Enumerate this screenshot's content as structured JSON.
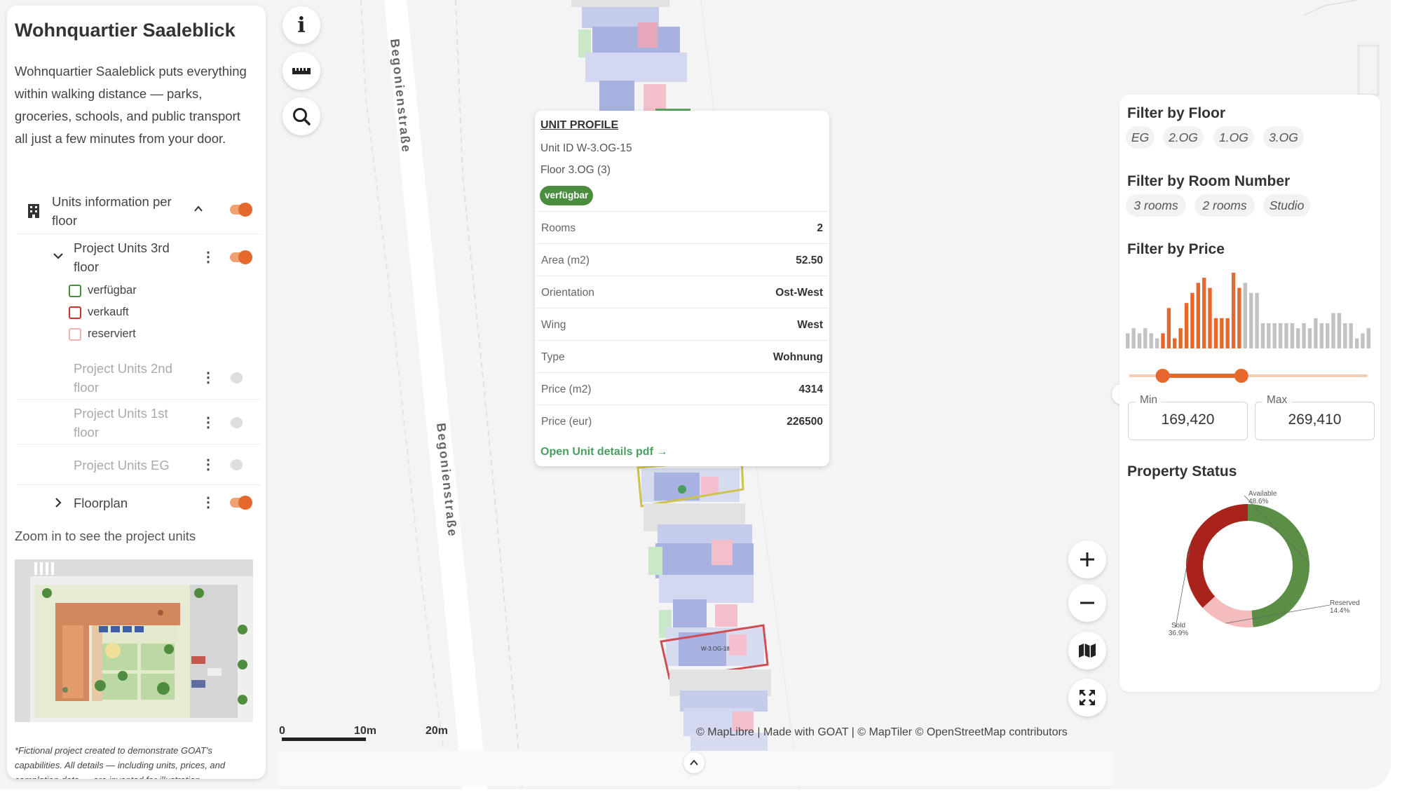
{
  "sidebar": {
    "title": "Wohnquartier Saaleblick",
    "description": "Wohnquartier Saaleblick puts everything within walking distance — parks, groceries, schools, and public transport all just a few minutes from your door.",
    "layers": [
      {
        "label": "Units information per floor",
        "icon": "building-icon",
        "enabled": true
      },
      {
        "label": "Project Units 3rd floor",
        "enabled": true
      },
      {
        "label": "Project Units 2nd floor",
        "enabled": false
      },
      {
        "label": "Project Units 1st floor",
        "enabled": false
      },
      {
        "label": "Project Units EG",
        "enabled": false
      },
      {
        "label": "Floorplan",
        "enabled": true
      }
    ],
    "legend": [
      {
        "label": "verfügbar",
        "color": "#4a8d3f"
      },
      {
        "label": "verkauft",
        "color": "#c0392b"
      },
      {
        "label": "reserviert",
        "color": "#f0b4b4"
      }
    ],
    "zoom_hint": "Zoom in to see the project units",
    "disclaimer": "*Fictional project created to demonstrate GOAT's capabilities. All details — including units, prices, and completion date — are invented for illustration."
  },
  "map": {
    "street_name": "Begonienstraße",
    "unit_label": "W-3.OG-18",
    "scale": [
      "0",
      "10m",
      "20m"
    ],
    "attribution": "© MapLibre | Made with GOAT | © MapTiler © OpenStreetMap contributors"
  },
  "popup": {
    "title": "UNIT PROFILE",
    "unit_id": "Unit ID W-3.OG-15",
    "floor": "Floor 3.OG (3)",
    "status": "verfügbar",
    "rows": [
      {
        "key": "Rooms",
        "value": "2"
      },
      {
        "key": "Area (m2)",
        "value": "52.50"
      },
      {
        "key": "Orientation",
        "value": "Ost-West"
      },
      {
        "key": "Wing",
        "value": "West"
      },
      {
        "key": "Type",
        "value": "Wohnung"
      },
      {
        "key": "Price (m2)",
        "value": "4314"
      },
      {
        "key": "Price (eur)",
        "value": "226500"
      }
    ],
    "link": "Open Unit details pdf →"
  },
  "filters": {
    "floor_title": "Filter by Floor",
    "floors": [
      "EG",
      "2.OG",
      "1.OG",
      "3.OG"
    ],
    "rooms_title": "Filter by Room Number",
    "rooms": [
      "3 rooms",
      "2 rooms",
      "Studio"
    ],
    "price_title": "Filter by Price",
    "min_label": "Min",
    "min_value": "169,420",
    "max_label": "Max",
    "max_value": "269,410",
    "slider_range": [
      0.14,
      0.47
    ],
    "histogram": [
      3,
      4,
      3,
      4,
      3,
      2,
      3,
      8,
      2,
      4,
      9,
      11,
      13,
      14,
      12,
      6,
      6,
      6,
      15,
      12,
      13,
      11,
      11,
      5,
      5,
      5,
      5,
      5,
      5,
      4,
      5,
      4,
      6,
      5,
      5,
      7,
      7,
      5,
      5,
      2,
      3,
      4
    ]
  },
  "status_chart": {
    "title": "Property Status",
    "slices": [
      {
        "label": "Available",
        "pct": "48.6%",
        "value": 48.6,
        "color": "#5a8f45"
      },
      {
        "label": "Reserved",
        "pct": "14.4%",
        "value": 14.4,
        "color": "#f4bcbc"
      },
      {
        "label": "Sold",
        "pct": "36.9%",
        "value": 36.9,
        "color": "#a8231b"
      }
    ]
  },
  "colors": {
    "accent": "#e5692c",
    "available": "#4a8d3f",
    "link": "#4a9d5e"
  }
}
